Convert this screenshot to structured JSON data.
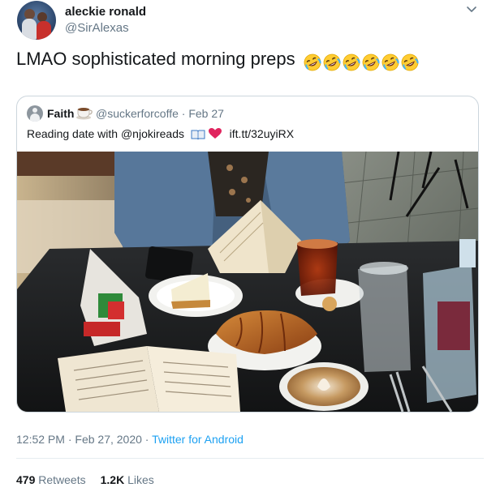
{
  "author": {
    "name": "aleckie ronald",
    "handle": "@SirAlexas"
  },
  "tweet": {
    "text": "LMAO sophisticated morning preps",
    "emoji_count": 6,
    "emoji_icon": "rolling-on-floor-laughing-icon"
  },
  "quoted": {
    "name": "Faith",
    "handle": "@suckerforcoffe",
    "separator": "·",
    "date": "Feb 27",
    "text_prefix": "Reading date with @njokireads",
    "link": "ift.tt/32uyiRX",
    "photo_icon": "photo-image"
  },
  "meta": {
    "time": "12:52 PM",
    "separator": "·",
    "date": "Feb 27, 2020",
    "source": "Twitter for Android"
  },
  "stats": {
    "retweets_count": "479",
    "retweets_label": "Retweets",
    "likes_count": "1.2K",
    "likes_label": "Likes"
  },
  "colors": {
    "link": "#1da1f2",
    "secondary_text": "#657786",
    "border": "#ccd6dd"
  }
}
